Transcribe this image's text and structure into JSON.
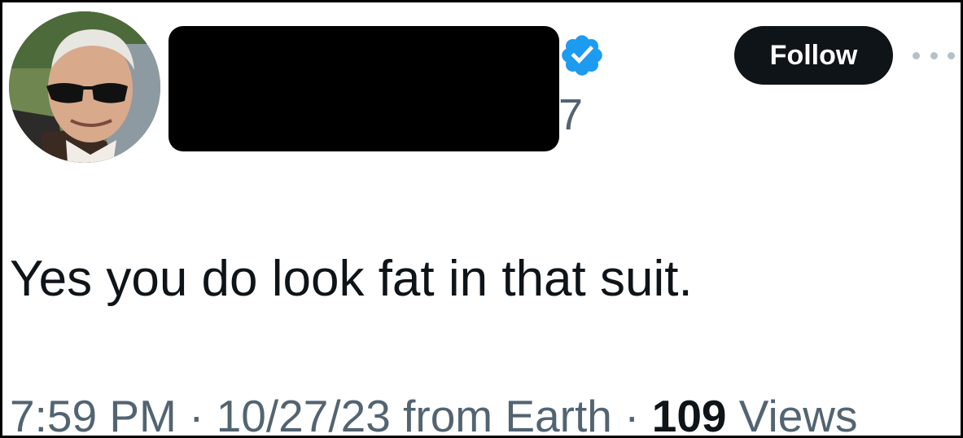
{
  "header": {
    "avatar_icon": "user-avatar-photo",
    "display_name": "",
    "handle_fragment": "7",
    "verified_icon": "verified-badge-icon",
    "verified_color": "#1d9bf0",
    "follow_label": "Follow",
    "more_icon": "more-options-icon"
  },
  "tweet": {
    "text": "Yes you do look fat in that suit."
  },
  "meta": {
    "time": "7:59 PM",
    "sep1": " · ",
    "date": "10/27/23",
    "source": " from Earth",
    "sep2": " · ",
    "views_count": "109",
    "views_label": " Views"
  },
  "colors": {
    "text_primary": "#0f1419",
    "text_secondary": "#536471",
    "button_bg": "#0f1419",
    "button_text": "#ffffff"
  }
}
